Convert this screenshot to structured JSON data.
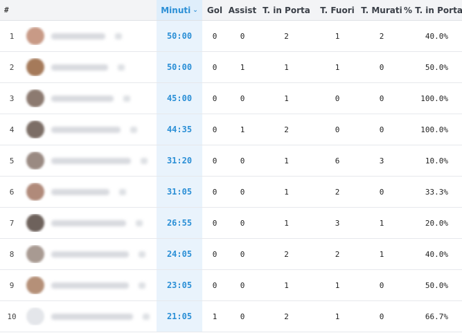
{
  "table": {
    "headers": {
      "num": "#",
      "minutes": "Minuti",
      "goals": "Gol",
      "assists": "Assist",
      "shots_on": "T. in Porta",
      "shots_off": "T. Fuori",
      "shots_blocked": "T. Murati",
      "pct_on": "% T. in Porta"
    },
    "sort_icon": "chevron-down-icon",
    "rows": [
      {
        "num": "1",
        "minutes": "50:00",
        "goals": "0",
        "assists": "0",
        "shots_on": "2",
        "shots_off": "1",
        "shots_blocked": "2",
        "pct_on": "40.0%",
        "avatar_color": "#c89a86"
      },
      {
        "num": "2",
        "minutes": "50:00",
        "goals": "0",
        "assists": "1",
        "shots_on": "1",
        "shots_off": "1",
        "shots_blocked": "0",
        "pct_on": "50.0%",
        "avatar_color": "#a57a5a"
      },
      {
        "num": "3",
        "minutes": "45:00",
        "goals": "0",
        "assists": "0",
        "shots_on": "1",
        "shots_off": "0",
        "shots_blocked": "0",
        "pct_on": "100.0%",
        "avatar_color": "#8c7a70"
      },
      {
        "num": "4",
        "minutes": "44:35",
        "goals": "0",
        "assists": "1",
        "shots_on": "2",
        "shots_off": "0",
        "shots_blocked": "0",
        "pct_on": "100.0%",
        "avatar_color": "#7c6e66"
      },
      {
        "num": "5",
        "minutes": "31:20",
        "goals": "0",
        "assists": "0",
        "shots_on": "1",
        "shots_off": "6",
        "shots_blocked": "3",
        "pct_on": "10.0%",
        "avatar_color": "#9a8a82"
      },
      {
        "num": "6",
        "minutes": "31:05",
        "goals": "0",
        "assists": "0",
        "shots_on": "1",
        "shots_off": "2",
        "shots_blocked": "0",
        "pct_on": "33.3%",
        "avatar_color": "#b08a7a"
      },
      {
        "num": "7",
        "minutes": "26:55",
        "goals": "0",
        "assists": "0",
        "shots_on": "1",
        "shots_off": "3",
        "shots_blocked": "1",
        "pct_on": "20.0%",
        "avatar_color": "#6e625c"
      },
      {
        "num": "8",
        "minutes": "24:05",
        "goals": "0",
        "assists": "0",
        "shots_on": "2",
        "shots_off": "2",
        "shots_blocked": "1",
        "pct_on": "40.0%",
        "avatar_color": "#a89a92"
      },
      {
        "num": "9",
        "minutes": "23:05",
        "goals": "0",
        "assists": "0",
        "shots_on": "1",
        "shots_off": "1",
        "shots_blocked": "0",
        "pct_on": "50.0%",
        "avatar_color": "#b59078"
      },
      {
        "num": "10",
        "minutes": "21:05",
        "goals": "1",
        "assists": "0",
        "shots_on": "2",
        "shots_off": "1",
        "shots_blocked": "0",
        "pct_on": "66.7%",
        "avatar_color": "#e4e6ea"
      }
    ]
  }
}
